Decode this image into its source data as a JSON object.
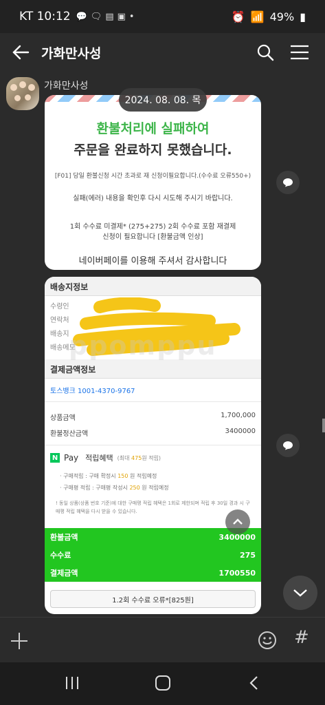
{
  "status_bar": {
    "carrier_time": "KT 10:12",
    "icons": [
      "message-icon",
      "talk-icon",
      "card-icon",
      "image-icon",
      "dot"
    ],
    "battery": "49%"
  },
  "header": {
    "title": "가화만사성"
  },
  "message": {
    "sender": "가화만사성",
    "date": "2024. 08. 08. 목"
  },
  "refund_notice": {
    "title": "환불처리에 실패하여",
    "subtitle": "주문을 완료하지 못했습니다.",
    "line1": "[F01] 당일 환불신청 시간 초과로 재 신청이필요합니다.(수수료 오류550+)",
    "line2": "실패(에러) 내용을 확인후 다시 시도해 주시기 바랍니다.",
    "line3a": "1회 수수료 미결제* (275+275) 2회 수수료 포함 재결제",
    "line3b": "신청이 필요합니다 [환불금액 인상]",
    "thanks": "네이버페이를 이용해 주셔서 감사합니다"
  },
  "order_detail": {
    "shipping_header": "배송지정보",
    "shipping_labels": [
      "수령인",
      "연락처",
      "배송지",
      "배송메모"
    ],
    "payment_header": "결제금액정보",
    "bank_account": "토스뱅크 1001-4370-9767",
    "payment_rows": [
      {
        "label": "상품금액",
        "value": "1,700,000"
      },
      {
        "label": "환불정산금액",
        "value": "3400000"
      }
    ],
    "npay": {
      "logo": "N",
      "pay": "Pay",
      "benefit": "적립혜택",
      "limit_pre": "(최대 ",
      "limit_amt": "475",
      "limit_post": "원 적립)",
      "details": [
        {
          "pre": "구매적립 : 구매 확정시 ",
          "amt": "150",
          "post": " 원 적립예정"
        },
        {
          "pre": "구매평 적립 : 구매평 작성시 ",
          "amt": "250",
          "post": " 원 적립예정"
        }
      ],
      "note": "! 동일 상품(상품 번호 기준)에 대한 구매평 적립 혜택은 1회로 제한되며 적립 후 30일 경과 시 구매평 적립 혜택을 다시 받을 수 있습니다."
    },
    "totals": [
      {
        "label": "환불금액",
        "value": "3400000"
      },
      {
        "label": "수수료",
        "value": "275"
      },
      {
        "label": "결제금액",
        "value": "1700550"
      }
    ],
    "error_button": "1.2회 수수료 오류*[825원]"
  },
  "watermark": "ppomppu",
  "colors": {
    "background": "#2b2b2b",
    "green": "#22c620",
    "green_text": "#3db54a",
    "redaction": "#f5c518"
  }
}
